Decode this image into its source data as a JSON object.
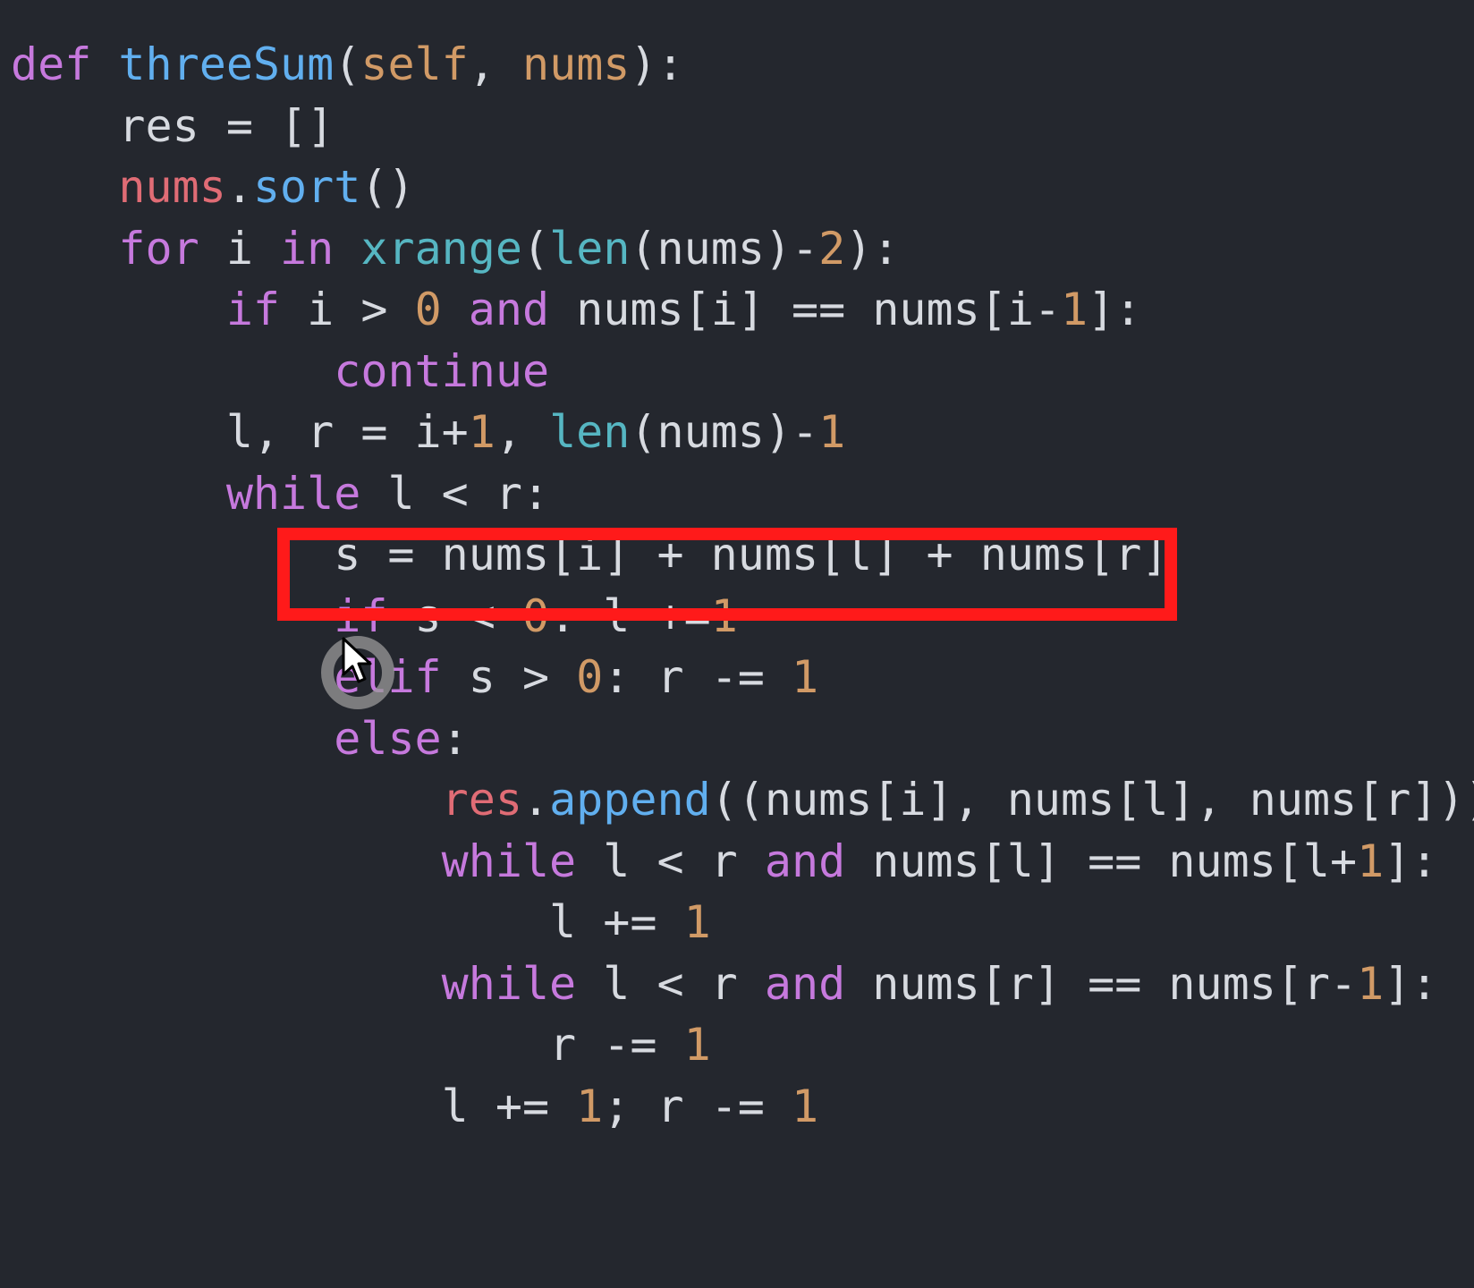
{
  "colors": {
    "background": "#24272e",
    "keyword": "#c679dd",
    "function": "#61afef",
    "number": "#d19a66",
    "variable": "#e06c75",
    "builtin": "#56b6c2",
    "text": "#d7dae0",
    "highlight": "#ff1a1a"
  },
  "code": {
    "lines": [
      [
        [
          "def",
          "kw"
        ],
        [
          " ",
          "txt"
        ],
        [
          "threeSum",
          "fn"
        ],
        [
          "(",
          "txt"
        ],
        [
          "self",
          "param"
        ],
        [
          ", ",
          "txt"
        ],
        [
          "nums",
          "param"
        ],
        [
          "):",
          "txt"
        ]
      ],
      [
        [
          "    res = []",
          "txt"
        ]
      ],
      [
        [
          "    ",
          "txt"
        ],
        [
          "nums",
          "var"
        ],
        [
          ".",
          "txt"
        ],
        [
          "sort",
          "fn"
        ],
        [
          "()",
          "txt"
        ]
      ],
      [
        [
          "    ",
          "txt"
        ],
        [
          "for",
          "kw"
        ],
        [
          " i ",
          "txt"
        ],
        [
          "in",
          "kw"
        ],
        [
          " ",
          "txt"
        ],
        [
          "xrange",
          "bi"
        ],
        [
          "(",
          "txt"
        ],
        [
          "len",
          "bi"
        ],
        [
          "(nums)-",
          "txt"
        ],
        [
          "2",
          "num"
        ],
        [
          "):",
          "txt"
        ]
      ],
      [
        [
          "        ",
          "txt"
        ],
        [
          "if",
          "kw"
        ],
        [
          " i > ",
          "txt"
        ],
        [
          "0",
          "num"
        ],
        [
          " ",
          "txt"
        ],
        [
          "and",
          "kw"
        ],
        [
          " nums[i] == nums[i-",
          "txt"
        ],
        [
          "1",
          "num"
        ],
        [
          "]:",
          "txt"
        ]
      ],
      [
        [
          "            ",
          "txt"
        ],
        [
          "continue",
          "kw"
        ]
      ],
      [
        [
          "        l, r = i+",
          "txt"
        ],
        [
          "1",
          "num"
        ],
        [
          ", ",
          "txt"
        ],
        [
          "len",
          "bi"
        ],
        [
          "(nums)-",
          "txt"
        ],
        [
          "1",
          "num"
        ]
      ],
      [
        [
          "        ",
          "txt"
        ],
        [
          "while",
          "kw"
        ],
        [
          " l < r:",
          "txt"
        ]
      ],
      [
        [
          "            s = nums[i] + nums[l] + nums[r]",
          "txt"
        ]
      ],
      [
        [
          "            ",
          "txt"
        ],
        [
          "if",
          "kw"
        ],
        [
          " s < ",
          "txt"
        ],
        [
          "0",
          "num"
        ],
        [
          ": l +=",
          "txt"
        ],
        [
          "1",
          "num"
        ]
      ],
      [
        [
          "            ",
          "txt"
        ],
        [
          "elif",
          "kw"
        ],
        [
          " s > ",
          "txt"
        ],
        [
          "0",
          "num"
        ],
        [
          ": r -= ",
          "txt"
        ],
        [
          "1",
          "num"
        ]
      ],
      [
        [
          "            ",
          "txt"
        ],
        [
          "else",
          "kw"
        ],
        [
          ":",
          "txt"
        ]
      ],
      [
        [
          "                ",
          "txt"
        ],
        [
          "res",
          "var"
        ],
        [
          ".",
          "txt"
        ],
        [
          "append",
          "fn"
        ],
        [
          "((nums[i], nums[l], nums[r]))",
          "txt"
        ]
      ],
      [
        [
          "                ",
          "txt"
        ],
        [
          "while",
          "kw"
        ],
        [
          " l < r ",
          "txt"
        ],
        [
          "and",
          "kw"
        ],
        [
          " nums[l] == nums[l+",
          "txt"
        ],
        [
          "1",
          "num"
        ],
        [
          "]:",
          "txt"
        ]
      ],
      [
        [
          "                    l += ",
          "txt"
        ],
        [
          "1",
          "num"
        ]
      ],
      [
        [
          "                ",
          "txt"
        ],
        [
          "while",
          "kw"
        ],
        [
          " l < r ",
          "txt"
        ],
        [
          "and",
          "kw"
        ],
        [
          " nums[r] == nums[r-",
          "txt"
        ],
        [
          "1",
          "num"
        ],
        [
          "]:",
          "txt"
        ]
      ],
      [
        [
          "                    r -= ",
          "txt"
        ],
        [
          "1",
          "num"
        ]
      ],
      [
        [
          "                l += ",
          "txt"
        ],
        [
          "1",
          "num"
        ],
        [
          "; r -= ",
          "txt"
        ],
        [
          "1",
          "num"
        ]
      ]
    ]
  },
  "icons": {
    "cursor": "mouse-pointer-icon",
    "loading": "loading-ring-icon"
  }
}
